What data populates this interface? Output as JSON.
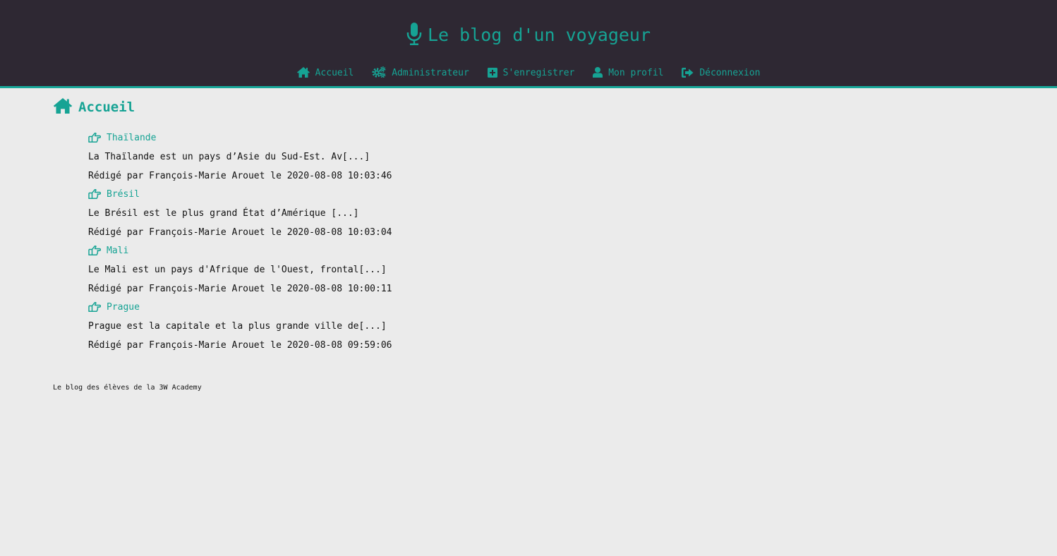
{
  "header": {
    "site_title": "Le blog d'un voyageur",
    "title_icon": "microphone-icon",
    "nav": [
      {
        "label": "Accueil",
        "icon": "home-icon"
      },
      {
        "label": "Administrateur",
        "icon": "cogs-icon"
      },
      {
        "label": "S'enregistrer",
        "icon": "plus-square-icon"
      },
      {
        "label": "Mon profil",
        "icon": "user-icon"
      },
      {
        "label": "Déconnexion",
        "icon": "sign-out-icon"
      }
    ]
  },
  "main": {
    "heading": "Accueil",
    "heading_icon": "home-icon",
    "articles": [
      {
        "title": "Thaïlande",
        "excerpt": "La Thaïlande est un pays d’Asie du Sud-Est. Av[...]",
        "meta": "Rédigé par François-Marie Arouet le 2020-08-08 10:03:46"
      },
      {
        "title": "Brésil",
        "excerpt": "Le Brésil est le plus grand État d’Amérique [...]",
        "meta": "Rédigé par François-Marie Arouet le 2020-08-08 10:03:04"
      },
      {
        "title": "Mali",
        "excerpt": "Le Mali est un pays d'Afrique de l'Ouest, frontal[...]",
        "meta": "Rédigé par François-Marie Arouet le 2020-08-08 10:00:11"
      },
      {
        "title": "Prague",
        "excerpt": "Prague est la capitale et la plus grande ville de[...]",
        "meta": "Rédigé par François-Marie Arouet le 2020-08-08 09:59:06"
      }
    ]
  },
  "footer": {
    "text": "Le blog des élèves de la 3W Academy"
  },
  "colors": {
    "accent": "#16a394",
    "header_bg": "#2e2833",
    "page_bg": "#ebebeb"
  }
}
